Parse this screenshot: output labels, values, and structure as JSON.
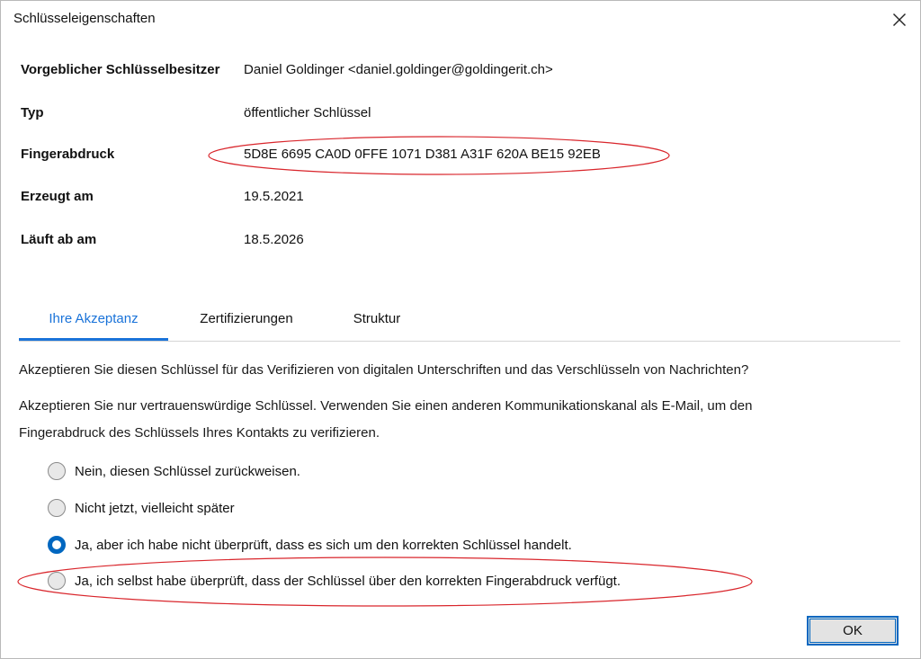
{
  "window": {
    "title": "Schlüsseleigenschaften"
  },
  "properties": [
    {
      "label": "Vorgeblicher Schlüsselbesitzer",
      "value": "Daniel Goldinger <daniel.goldinger@goldingerit.ch>"
    },
    {
      "label": "Typ",
      "value": "öffentlicher Schlüssel"
    },
    {
      "label": "Fingerabdruck",
      "value": "5D8E 6695 CA0D 0FFE 1071 D381 A31F 620A BE15 92EB"
    },
    {
      "label": "Erzeugt am",
      "value": "19.5.2021"
    },
    {
      "label": "Läuft ab am",
      "value": "18.5.2026"
    }
  ],
  "tabs": [
    {
      "label": "Ihre Akzeptanz",
      "active": true
    },
    {
      "label": "Zertifizierungen",
      "active": false
    },
    {
      "label": "Struktur",
      "active": false
    }
  ],
  "acceptance": {
    "question": "Akzeptieren Sie diesen Schlüssel für das Verifizieren von digitalen Unterschriften und das Verschlüsseln von Nachrichten?",
    "hint_line1": "Akzeptieren Sie nur vertrauenswürdige Schlüssel. Verwenden Sie einen anderen Kommunikationskanal als E-Mail, um den",
    "hint_line2": "Fingerabdruck des Schlüssels Ihres Kontakts zu verifizieren.",
    "options": [
      {
        "label": "Nein, diesen Schlüssel zurückweisen.",
        "selected": false
      },
      {
        "label": "Nicht jetzt, vielleicht später",
        "selected": false
      },
      {
        "label": "Ja, aber ich habe nicht überprüft, dass es sich um den korrekten Schlüssel handelt.",
        "selected": true
      },
      {
        "label": "Ja, ich selbst habe überprüft, dass der Schlüssel über den korrekten Fingerabdruck verfügt.",
        "selected": false
      }
    ]
  },
  "buttons": {
    "ok": "OK"
  },
  "colors": {
    "accent": "#0067c0",
    "tab_active": "#1a73d9",
    "annotation": "#d9262c"
  },
  "icons": {
    "close": "close-icon"
  }
}
